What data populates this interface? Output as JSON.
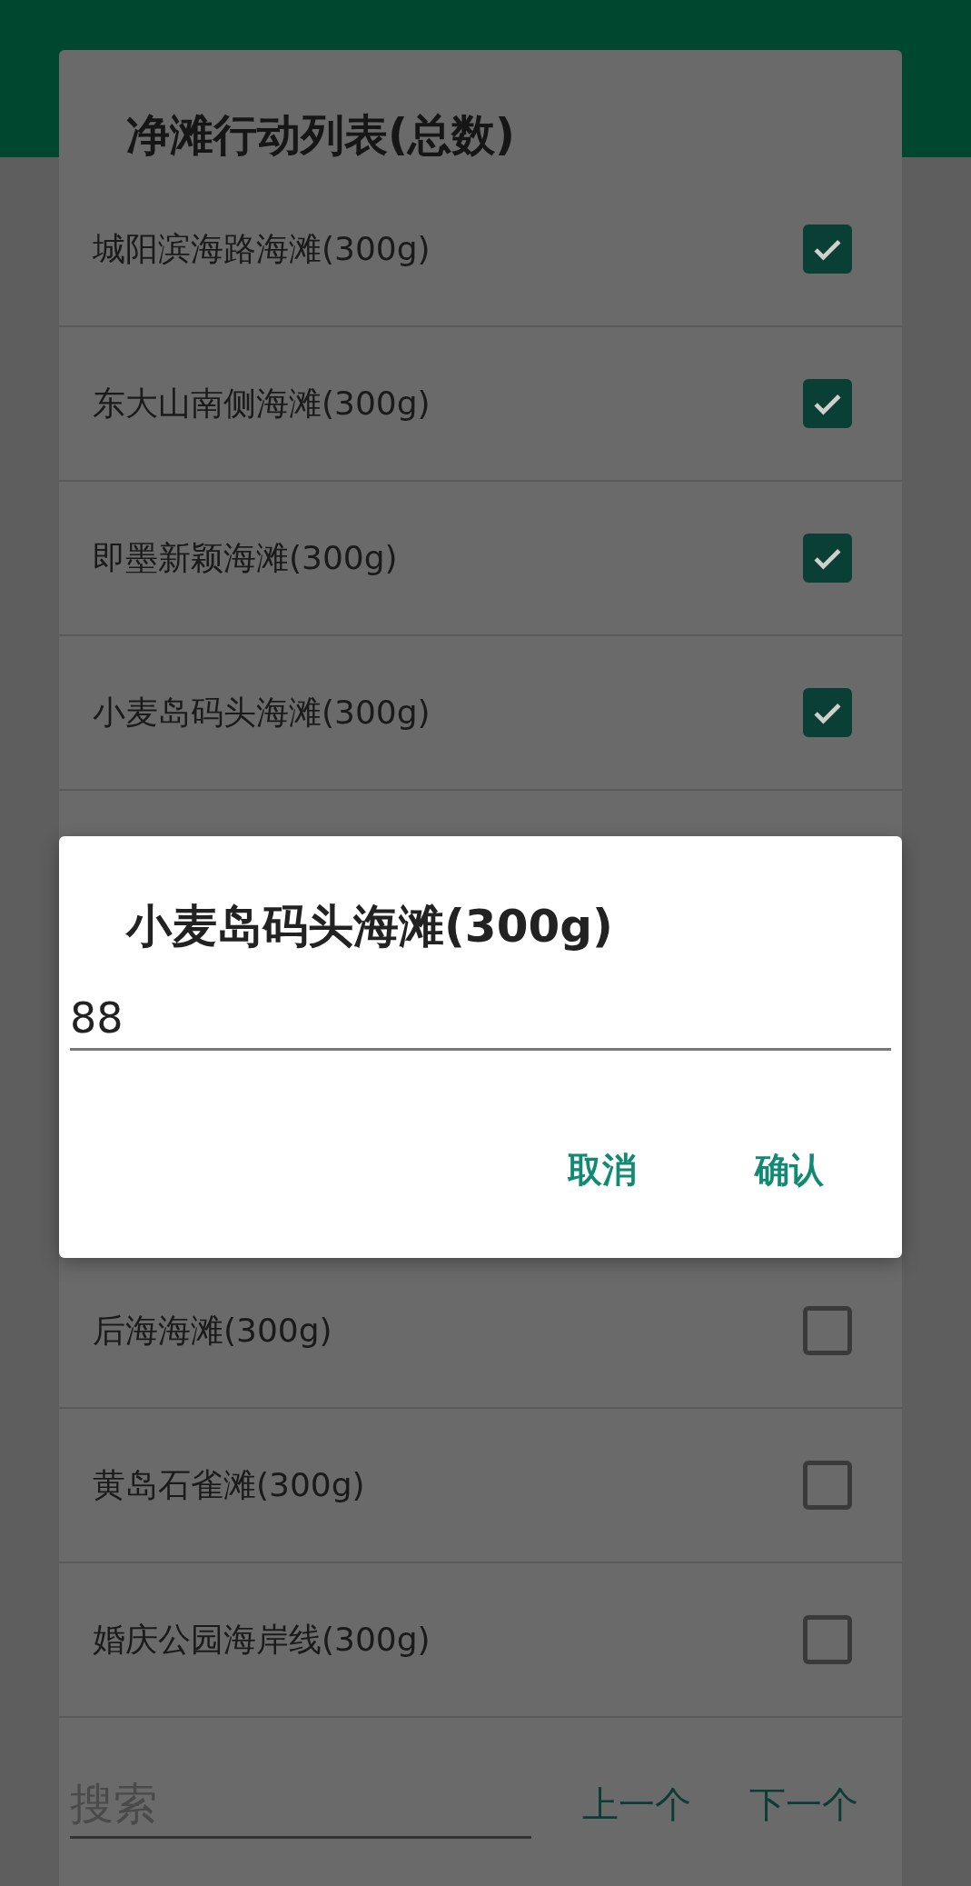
{
  "list_dialog": {
    "title": "净滩行动列表(总数)",
    "items_before": [
      {
        "label": "城阳滨海路海滩(300g)",
        "checked": true
      },
      {
        "label": "东大山南侧海滩(300g)",
        "checked": true
      },
      {
        "label": "即墨新颖海滩(300g)",
        "checked": true
      },
      {
        "label": "小麦岛码头海滩(300g)",
        "checked": true
      }
    ],
    "items_after": [
      {
        "label": "后海海滩(300g)",
        "checked": false
      },
      {
        "label": "黄岛石雀滩(300g)",
        "checked": false
      },
      {
        "label": "婚庆公园海岸线(300g)",
        "checked": false
      }
    ],
    "search": {
      "placeholder": "搜索"
    },
    "buttons": [
      "上一个",
      "下一个"
    ]
  },
  "input_dialog": {
    "title": "小麦岛码头海滩(300g)",
    "value": "88",
    "buttons": [
      "取消",
      "确认"
    ]
  }
}
